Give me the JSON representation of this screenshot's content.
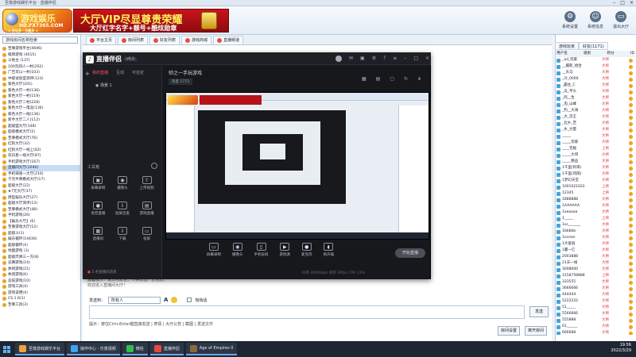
{
  "window": {
    "title": "至尊游戏娱乐平台 · 直播伴侣"
  },
  "topbar": {
    "logo_main": "游戏娱乐",
    "logo_sub": "HD.FX7365.COM",
    "logo_tag": "★ 好玩多 · 乐趣多 ★",
    "vip_line1": "大厅VIP尽显尊贵荣耀",
    "vip_line2": "大厅红字名字+靓号+酷炫勋章",
    "icons": [
      {
        "name": "gear-icon",
        "glyph": "⚙",
        "label": "系统设置"
      },
      {
        "name": "smile-icon",
        "glyph": "☺",
        "label": "系统信息"
      },
      {
        "name": "monitor-icon",
        "glyph": "▭",
        "label": "退出大厅"
      }
    ]
  },
  "left": {
    "search_text": "游戏房间名称检索",
    "tree": [
      {
        "label": "至尊游戏平台(4696)",
        "hl": false
      },
      {
        "label": "棋牌游戏 (4015)",
        "hl": false
      },
      {
        "label": "  斗地主 (137)",
        "hl": false
      },
      {
        "label": "   100元四人一村(202)",
        "hl": false
      },
      {
        "label": "   广告可以一村(103)",
        "hl": false
      },
      {
        "label": "   中级试验室测评(123)",
        "hl": false
      },
      {
        "label": "   紫色大厅(201)",
        "hl": false
      },
      {
        "label": "   紫色大厅一村(136)",
        "hl": false
      },
      {
        "label": "   紫色大厅一村(119)",
        "hl": false
      },
      {
        "label": "   紫色大厅二村(228)",
        "hl": false
      },
      {
        "label": "   紫色大厅一电竞(136)",
        "hl": false
      },
      {
        "label": "   紫色大厅一线(136)",
        "hl": false
      },
      {
        "label": "   新手大厅二人(112)",
        "hl": false
      },
      {
        "label": "   超级盟大厅(148)",
        "hl": false
      },
      {
        "label": "   超级模式大厅(2)",
        "hl": false
      },
      {
        "label": "   至尊模式大厅(76)",
        "hl": false
      },
      {
        "label": "   红狗大厅(32)",
        "hl": false
      },
      {
        "label": "   红狗大厅一线上(62)",
        "hl": false
      },
      {
        "label": "   双日星一线大厅(87)",
        "hl": false
      },
      {
        "label": "   手机游戏大厅(167)",
        "hl": false
      },
      {
        "label": "   直播间大厅(1040)",
        "hl": true
      },
      {
        "label": "   手机快速一大厅(210)",
        "hl": false
      },
      {
        "label": "   千元牛牌模式大厅(17)",
        "hl": false
      },
      {
        "label": "   超级大厅(22)",
        "hl": false
      },
      {
        "label": "   ★7元大厅(37)",
        "hl": false
      },
      {
        "label": "   牌型娱乐大厅(27)",
        "hl": false
      },
      {
        "label": "   超级大厅测评(13)",
        "hl": false
      },
      {
        "label": "   至尊模式大厅(48)",
        "hl": false
      },
      {
        "label": "   手机游戏(26)",
        "hl": false
      },
      {
        "label": "   【娱乐大厅】(6)",
        "hl": false
      },
      {
        "label": "   至尊游戏大厅(12)",
        "hl": false
      },
      {
        "label": "   超级斗(1)",
        "hl": false
      },
      {
        "label": "   娱乐循环(14436)",
        "hl": false
      },
      {
        "label": "   超级循环(4)",
        "hl": false
      },
      {
        "label": "地图游戏 (1)",
        "hl": false
      },
      {
        "label": "超级炸弹三一方(8)",
        "hl": false
      },
      {
        "label": "竞赛游戏(14)",
        "hl": false
      },
      {
        "label": "休闲游戏(21)",
        "hl": false
      },
      {
        "label": "休闲游戏(6)",
        "hl": false
      },
      {
        "label": "竞技游戏(10)",
        "hl": false
      },
      {
        "label": "游戏工具(4)",
        "hl": false
      },
      {
        "label": "游戏说明(4)",
        "hl": false
      },
      {
        "label": "CS 1.6(1)",
        "hl": false
      },
      {
        "label": "至尊工具(3)",
        "hl": false
      }
    ]
  },
  "tabs": [
    {
      "label": "平台主页",
      "icon": "home-icon"
    },
    {
      "label": "房间列表",
      "icon": "list-icon"
    },
    {
      "label": "好友列表",
      "icon": "friends-icon"
    },
    {
      "label": "游戏商城",
      "icon": "shop-icon"
    },
    {
      "label": "直播频道",
      "icon": "video-icon"
    }
  ],
  "room": {
    "notice": "温馨提示：请文明发言，不得发送广告信息。",
    "notice2": "欢迎进入直播间大厅！",
    "sender_label": "发送到：",
    "sender_select": "所有人",
    "checkbox": "悄悄话",
    "send": "发送",
    "tools": "提示：按住Ctrl+Enter键直接发送 | 表情 | 大厅公告 | 截图 | 发送文件",
    "btn_settings": "房间设置",
    "btn_exit": "离开房间"
  },
  "right": {
    "tabs": [
      "游戏玩家",
      "好友(1171)"
    ],
    "headers": [
      "用户名",
      "级别",
      "积分",
      "ID"
    ],
    "users": [
      {
        "n": "_ad_玩家",
        "lv": "大将"
      },
      {
        "n": "__摄影_组合",
        "lv": "大将"
      },
      {
        "n": "__天马",
        "lv": "大将"
      },
      {
        "n": "_冷_0000",
        "lv": "大将"
      },
      {
        "n": "_霸主_C",
        "lv": "大将"
      },
      {
        "n": "_瓜_平头",
        "lv": "大将"
      },
      {
        "n": "_阿__生",
        "lv": "大将"
      },
      {
        "n": "_淘_山峰",
        "lv": "大将"
      },
      {
        "n": "_钓__大海",
        "lv": "大将"
      },
      {
        "n": "_大_见王",
        "lv": "大将"
      },
      {
        "n": "_北乡_苦",
        "lv": "大将"
      },
      {
        "n": "_水_力量",
        "lv": "大将"
      },
      {
        "n": "_____",
        "lv": "大将"
      },
      {
        "n": "_____玩家",
        "lv": "大将"
      },
      {
        "n": "____无敌",
        "lv": "上将"
      },
      {
        "n": "_____大哥",
        "lv": "大将"
      },
      {
        "n": "_____精品",
        "lv": "大将"
      },
      {
        "n": "1千里(阿哥)",
        "lv": "大将"
      },
      {
        "n": "1千里(风雨)",
        "lv": "大将"
      },
      {
        "n": "1梦幻天堂",
        "lv": "大将"
      },
      {
        "n": "1001021022",
        "lv": "上将"
      },
      {
        "n": "12345",
        "lv": "上将"
      },
      {
        "n": "1888888",
        "lv": "大将"
      },
      {
        "n": "1AAAAAA",
        "lv": "大将"
      },
      {
        "n": "1aaaaaa",
        "lv": "大将"
      },
      {
        "n": "1_____",
        "lv": "上将"
      },
      {
        "n": "1ss_______",
        "lv": "大将"
      },
      {
        "n": "1bbbbb",
        "lv": "大将"
      },
      {
        "n": "1ocean",
        "lv": "大将"
      },
      {
        "n": "1大富翁",
        "lv": "大将"
      },
      {
        "n": "1赢一亿",
        "lv": "大将"
      },
      {
        "n": "2003888",
        "lv": "大将"
      },
      {
        "n": "21天一线",
        "lv": "大将"
      },
      {
        "n": "3008000",
        "lv": "大将"
      },
      {
        "n": "3158758888",
        "lv": "上将"
      },
      {
        "n": "333555",
        "lv": "大将"
      },
      {
        "n": "3666666",
        "lv": "大将"
      },
      {
        "n": "444444",
        "lv": "大将"
      },
      {
        "n": "5222222",
        "lv": "大将"
      },
      {
        "n": "51_____",
        "lv": "大将"
      },
      {
        "n": "5566666",
        "lv": "大将"
      },
      {
        "n": "555888",
        "lv": "大将"
      },
      {
        "n": "61______",
        "lv": "大将"
      },
      {
        "n": "666688",
        "lv": "大将"
      }
    ]
  },
  "overlay": {
    "app_name": "直播伴侣",
    "version": "v6.2",
    "tabs": [
      "我的直播",
      "互动",
      "可自定"
    ],
    "scene": "场景 1",
    "section": "工具箱",
    "tools": [
      {
        "name": "screen-record-icon",
        "glyph": "▣",
        "label": "屏幕录制"
      },
      {
        "name": "camera-icon",
        "glyph": "◉",
        "label": "摄像头"
      },
      {
        "name": "upload-icon",
        "glyph": "⇪",
        "label": "上传视频"
      },
      {
        "name": "mic-icon",
        "glyph": "●",
        "label": "语音直播"
      },
      {
        "name": "download-icon",
        "glyph": "⇩",
        "label": "投屏连麦"
      },
      {
        "name": "window-icon",
        "glyph": "▤",
        "label": "游戏直播"
      },
      {
        "name": "grid-icon",
        "glyph": "▦",
        "label": "直播间"
      },
      {
        "name": "arrow-down-icon",
        "glyph": "⇩",
        "label": "下载"
      },
      {
        "name": "monitor-icon",
        "glyph": "▭",
        "label": "投屏"
      }
    ],
    "status": "5 条直播间消息",
    "channel": "帅之一手玩游戏",
    "stats": "热度 1773",
    "controls": [
      {
        "name": "screen-icon",
        "glyph": "▭",
        "label": "屏幕录制"
      },
      {
        "name": "camera-icon",
        "glyph": "◉",
        "label": "摄像头"
      },
      {
        "name": "phone-icon",
        "glyph": "▯",
        "label": "手机投屏"
      },
      {
        "name": "game-icon",
        "glyph": "▶",
        "label": "游戏源"
      },
      {
        "name": "mic-icon",
        "glyph": "●",
        "label": "麦克风"
      },
      {
        "name": "speaker-icon",
        "glyph": "◖",
        "label": "扬声器"
      }
    ],
    "start_label": "开始直播",
    "bottom_info": "码率 2000kbps  帧率 30fps  CPU 23%"
  },
  "taskbar": {
    "items": [
      {
        "label": "至尊游戏娱乐平台",
        "color": "#f2a23a"
      },
      {
        "label": "操作中心 · 乐意视频",
        "color": "#3aa4f2"
      },
      {
        "label": "微信",
        "color": "#2fbf4a"
      },
      {
        "label": "直播伴侣",
        "color": "#e74a3a"
      },
      {
        "label": "Age of Empires II",
        "color": "#8b6a3a"
      }
    ],
    "time": "19:56",
    "date": "2022/3/29"
  }
}
